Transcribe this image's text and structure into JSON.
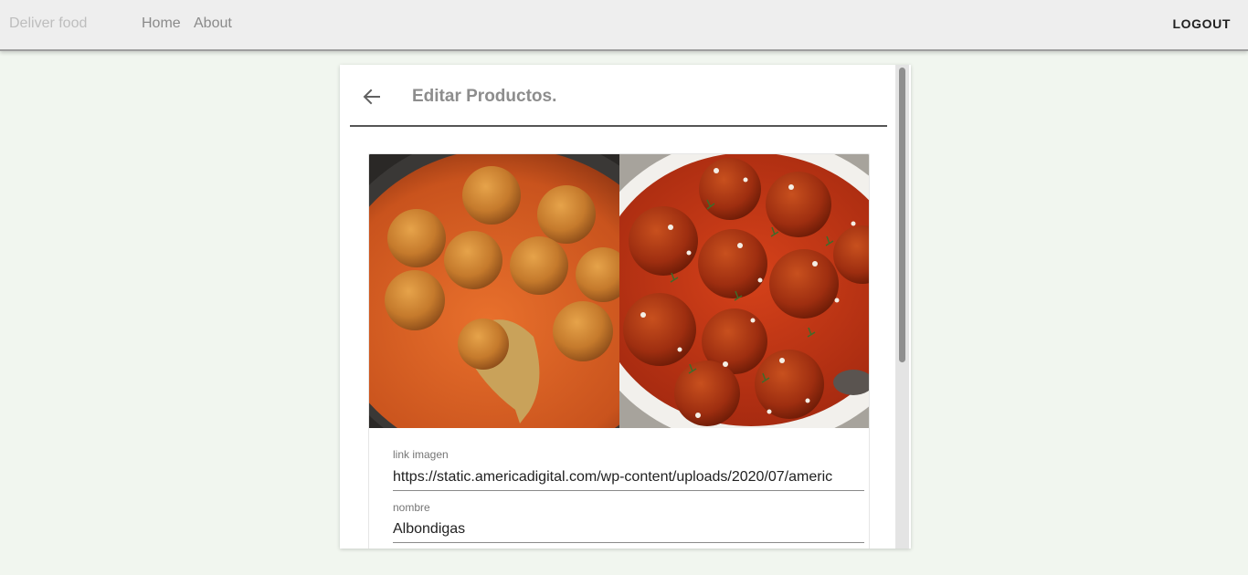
{
  "appbar": {
    "brand": "Deliver food",
    "nav": [
      {
        "label": "Home"
      },
      {
        "label": "About"
      }
    ],
    "logout_label": "LOGOUT"
  },
  "dialog": {
    "title": "Editar Productos.",
    "back_icon": "arrow-left-icon",
    "image_alt": "Albondigas",
    "fields": {
      "image_link": {
        "label": "link imagen",
        "value": "https://static.americadigital.com/wp-content/uploads/2020/07/americ"
      },
      "name": {
        "label": "nombre",
        "value": "Albondigas"
      }
    }
  },
  "colors": {
    "page_background": "#f1f6ef",
    "appbar_background": "#eeeeee",
    "title": "#8d8d8d"
  }
}
